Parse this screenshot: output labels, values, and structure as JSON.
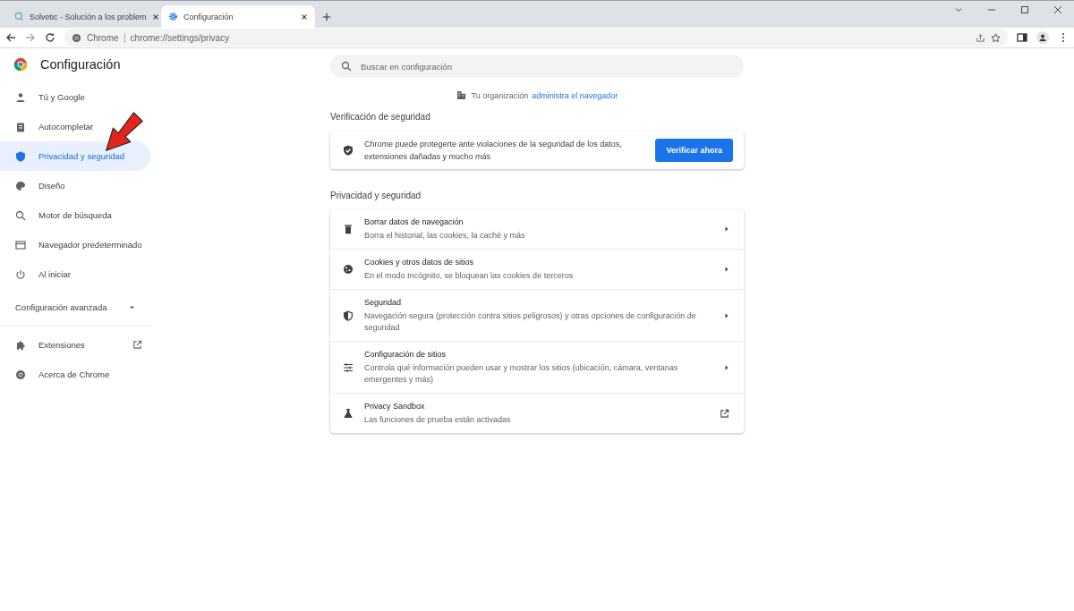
{
  "tabs": [
    {
      "title": "Solvetic - Solución a los problem",
      "selected": false
    },
    {
      "title": "Configuración",
      "selected": true
    }
  ],
  "address_bar": {
    "site_label": "Chrome",
    "url": "chrome://settings/privacy"
  },
  "sidebar": {
    "title": "Configuración",
    "items": [
      {
        "label": "Tú y Google",
        "selected": false
      },
      {
        "label": "Autocompletar",
        "selected": false
      },
      {
        "label": "Privacidad y seguridad",
        "selected": true
      },
      {
        "label": "Diseño",
        "selected": false
      },
      {
        "label": "Motor de búsqueda",
        "selected": false
      },
      {
        "label": "Navegador predeterminado",
        "selected": false
      },
      {
        "label": "Al iniciar",
        "selected": false
      }
    ],
    "advanced": {
      "label": "Configuración avanzada",
      "expanded": false
    },
    "footer_items": [
      {
        "label": "Extensiones",
        "kind": "external"
      },
      {
        "label": "Acerca de Chrome",
        "kind": "plain"
      }
    ]
  },
  "search": {
    "placeholder": "Buscar en configuración"
  },
  "managed_notice": {
    "text": "Tu organización",
    "link": "administra el navegador"
  },
  "safety_check": {
    "heading": "Verificación de seguridad",
    "text": "Chrome puede protegerte ante violaciones de la seguridad de los datos, extensiones dañadas y mucho más",
    "button": "Verificar ahora"
  },
  "privacy": {
    "heading": "Privacidad y seguridad",
    "rows": [
      {
        "title": "Borrar datos de navegación",
        "subtitle": "Borra el historial, las cookies, la caché y más",
        "kind": "arrow"
      },
      {
        "title": "Cookies y otros datos de sitios",
        "subtitle": "En el modo Incógnito, se bloquean las cookies de terceros",
        "kind": "arrow"
      },
      {
        "title": "Seguridad",
        "subtitle": "Navegación segura (protección contra sitios peligrosos) y otras opciones de configuración de seguridad",
        "kind": "arrow"
      },
      {
        "title": "Configuración de sitios",
        "subtitle": "Controla qué información pueden usar y mostrar los sitios (ubicación, cámara, ventanas emergentes y más)",
        "kind": "arrow"
      },
      {
        "title": "Privacy Sandbox",
        "subtitle": "Las funciones de prueba están activadas",
        "kind": "external"
      }
    ]
  }
}
